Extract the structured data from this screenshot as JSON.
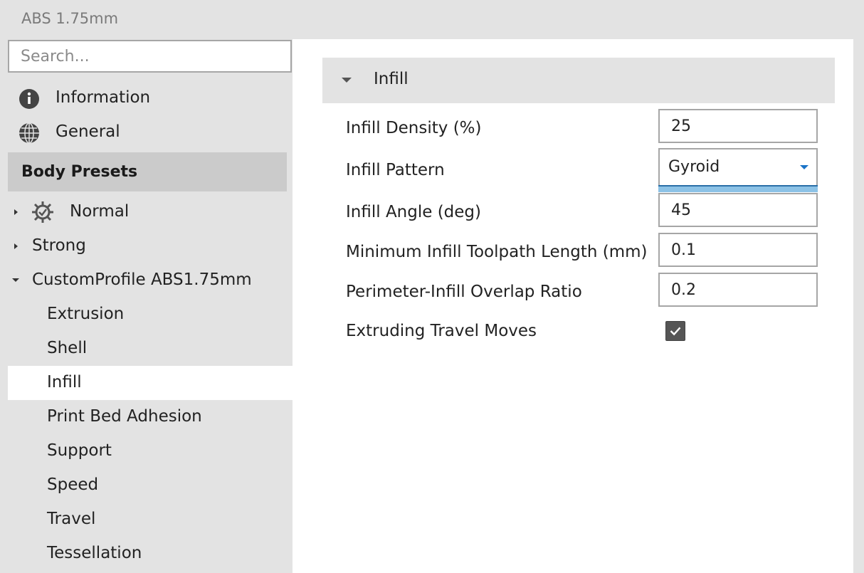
{
  "window": {
    "title": "ABS 1.75mm"
  },
  "search": {
    "placeholder": "Search..."
  },
  "sidebar": {
    "top_items": [
      {
        "label": "Information",
        "icon": "info-icon"
      },
      {
        "label": "General",
        "icon": "globe-icon"
      }
    ],
    "section_header": "Body Presets",
    "presets": [
      {
        "label": "Normal",
        "icon": "gear-check-icon",
        "expanded": false
      },
      {
        "label": "Strong",
        "expanded": false
      },
      {
        "label": "CustomProfile ABS1.75mm",
        "expanded": true
      }
    ],
    "children": [
      {
        "label": "Extrusion"
      },
      {
        "label": "Shell"
      },
      {
        "label": "Infill",
        "selected": true
      },
      {
        "label": "Print Bed Adhesion"
      },
      {
        "label": "Support"
      },
      {
        "label": "Speed"
      },
      {
        "label": "Travel"
      },
      {
        "label": "Tessellation"
      }
    ]
  },
  "main": {
    "group_title": "Infill",
    "properties": [
      {
        "label": "Infill Density (%)",
        "type": "number",
        "value": "25"
      },
      {
        "label": "Infill Pattern",
        "type": "select",
        "value": "Gyroid"
      },
      {
        "label": "Infill Angle (deg)",
        "type": "number",
        "value": "45"
      },
      {
        "label": "Minimum Infill Toolpath Length (mm)",
        "type": "number",
        "value": "0.1"
      },
      {
        "label": "Perimeter-Infill Overlap Ratio",
        "type": "number",
        "value": "0.2"
      },
      {
        "label": "Extruding Travel Moves",
        "type": "checkbox",
        "checked": true
      }
    ]
  },
  "colors": {
    "selection_accent": "#8cc2e6",
    "dropdown_arrow": "#1a73c7",
    "section_header_bg": "#cbcbcb"
  }
}
